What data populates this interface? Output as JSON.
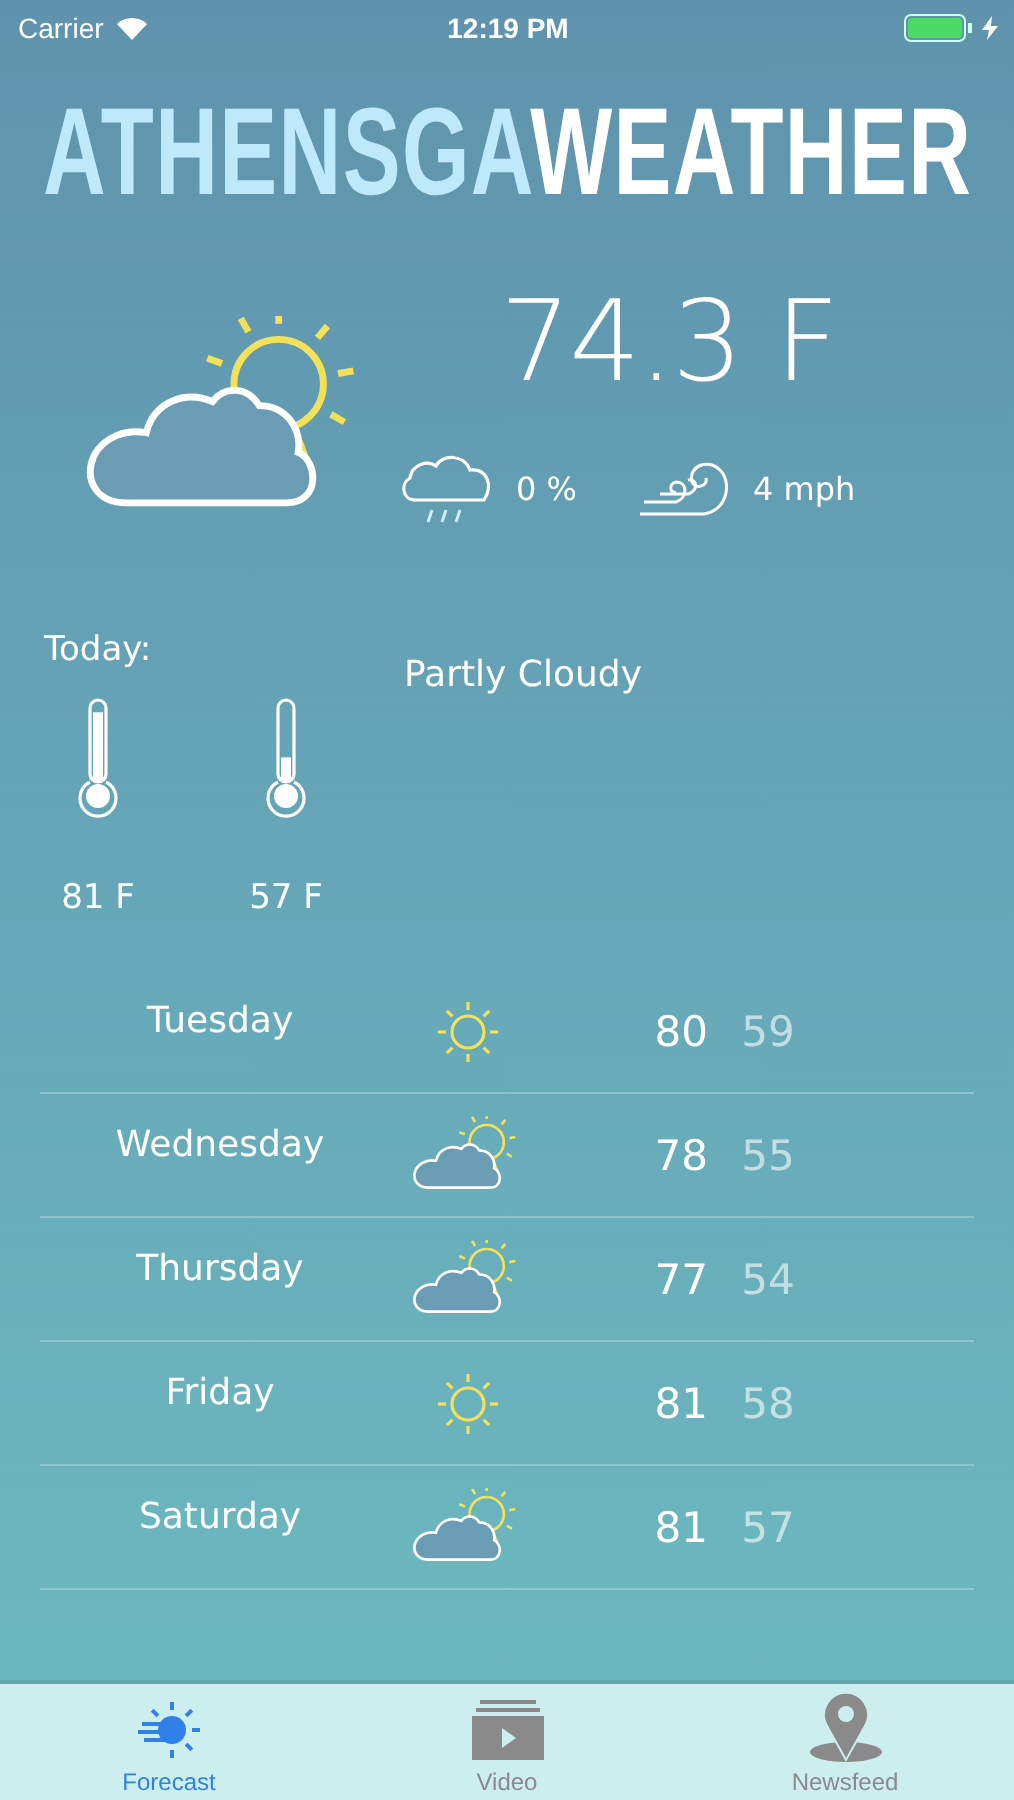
{
  "status_bar": {
    "carrier": "Carrier",
    "time": "12:19 PM"
  },
  "app_title": {
    "part_1": "ATHENSGA",
    "part_2": "WEATHER"
  },
  "current": {
    "kind": "partly_cloudy",
    "temperature": "74.3 F",
    "precipitation": "0 %",
    "wind": "4 mph",
    "condition": "Partly Cloudy"
  },
  "today": {
    "label": "Today:",
    "high": {
      "reading": "81 F",
      "level": 0.85
    },
    "low": {
      "reading": "57 F",
      "level": 0.3
    }
  },
  "forecast": [
    {
      "day": "Tuesday",
      "kind": "sunny",
      "high": "80",
      "low": "59"
    },
    {
      "day": "Wednesday",
      "kind": "partly_cloudy",
      "high": "78",
      "low": "55"
    },
    {
      "day": "Thursday",
      "kind": "partly_cloudy",
      "high": "77",
      "low": "54"
    },
    {
      "day": "Friday",
      "kind": "sunny",
      "high": "81",
      "low": "58"
    },
    {
      "day": "Saturday",
      "kind": "partly_cloudy",
      "high": "81",
      "low": "57"
    }
  ],
  "tab_bar": [
    {
      "label": "Forecast",
      "selected": true
    },
    {
      "label": "Video",
      "selected": false
    },
    {
      "label": "Newsfeed",
      "selected": false
    }
  ]
}
